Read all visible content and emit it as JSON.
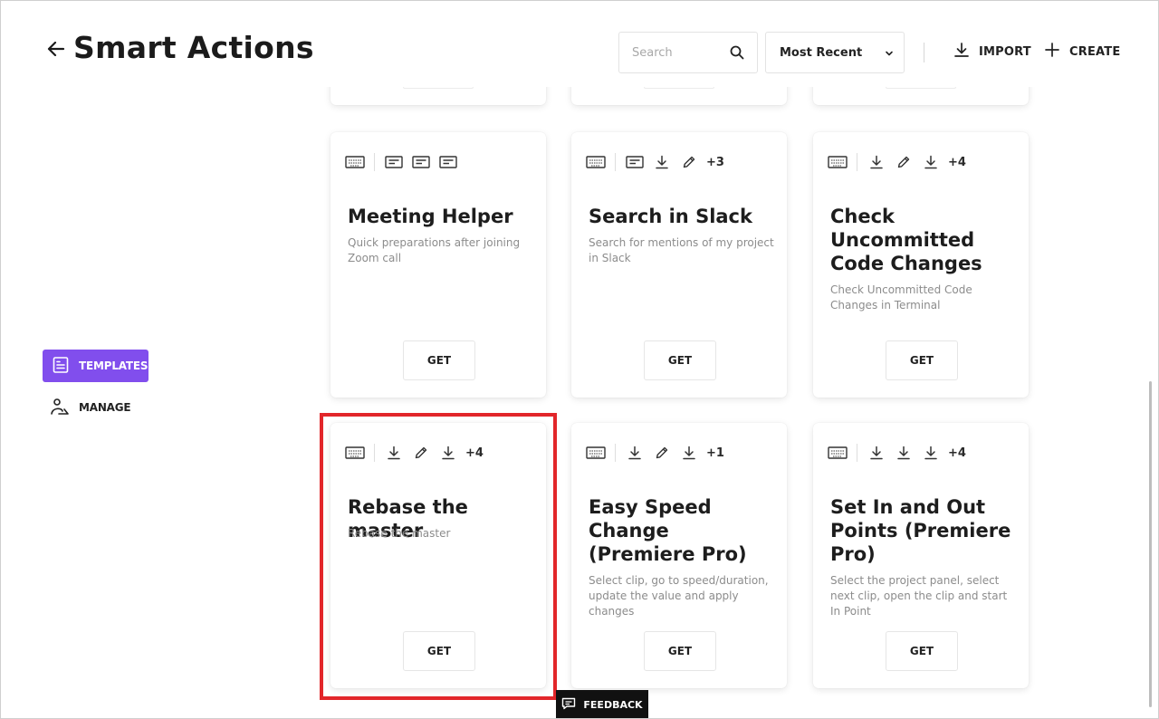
{
  "window": {
    "close_glyph": "✕"
  },
  "header": {
    "title": "Smart Actions",
    "search": {
      "placeholder": "Search",
      "value": ""
    },
    "sort": {
      "selected": "Most Recent"
    },
    "import_label": "IMPORT",
    "create_label": "CREATE"
  },
  "sidebar": {
    "items": [
      {
        "label": "TEMPLATES",
        "icon": "template-icon",
        "active": true
      },
      {
        "label": "MANAGE",
        "icon": "manage-icon",
        "active": false
      }
    ]
  },
  "cards": [
    {
      "title": "Meeting Helper",
      "description": "Quick preparations after joining Zoom call",
      "icons": [
        "keyboard-icon",
        "text-icon",
        "text-icon",
        "text-icon"
      ],
      "more": "",
      "get_label": "GET"
    },
    {
      "title": "Search in Slack",
      "description": "Search for mentions of my project in Slack",
      "icons": [
        "keyboard-icon",
        "text-icon",
        "download-icon",
        "pencil-icon"
      ],
      "more": "+3",
      "get_label": "GET"
    },
    {
      "title": "Check Uncommitted Code Changes",
      "description": "Check Uncommitted Code Changes in Terminal",
      "icons": [
        "keyboard-icon",
        "download-icon",
        "pencil-icon",
        "download-icon"
      ],
      "more": "+4",
      "get_label": "GET"
    },
    {
      "title": "Rebase the master",
      "description": "Rebase the master",
      "icons": [
        "keyboard-icon",
        "download-icon",
        "pencil-icon",
        "download-icon"
      ],
      "more": "+4",
      "get_label": "GET"
    },
    {
      "title": "Easy Speed Change (Premiere Pro)",
      "description": "Select clip, go to speed/duration, update the value and apply changes",
      "icons": [
        "keyboard-icon",
        "download-icon",
        "pencil-icon",
        "download-icon"
      ],
      "more": "+1",
      "get_label": "GET"
    },
    {
      "title": "Set In and Out Points (Premiere Pro)",
      "description": "Select the project panel, select next clip, open the clip and start In Point",
      "icons": [
        "keyboard-icon",
        "download-icon",
        "download-icon",
        "download-icon"
      ],
      "more": "+4",
      "get_label": "GET"
    }
  ],
  "feedback_label": "FEEDBACK",
  "colors": {
    "accent": "#814eed",
    "highlight": "#e2262a",
    "feedback_bg": "#111111"
  }
}
